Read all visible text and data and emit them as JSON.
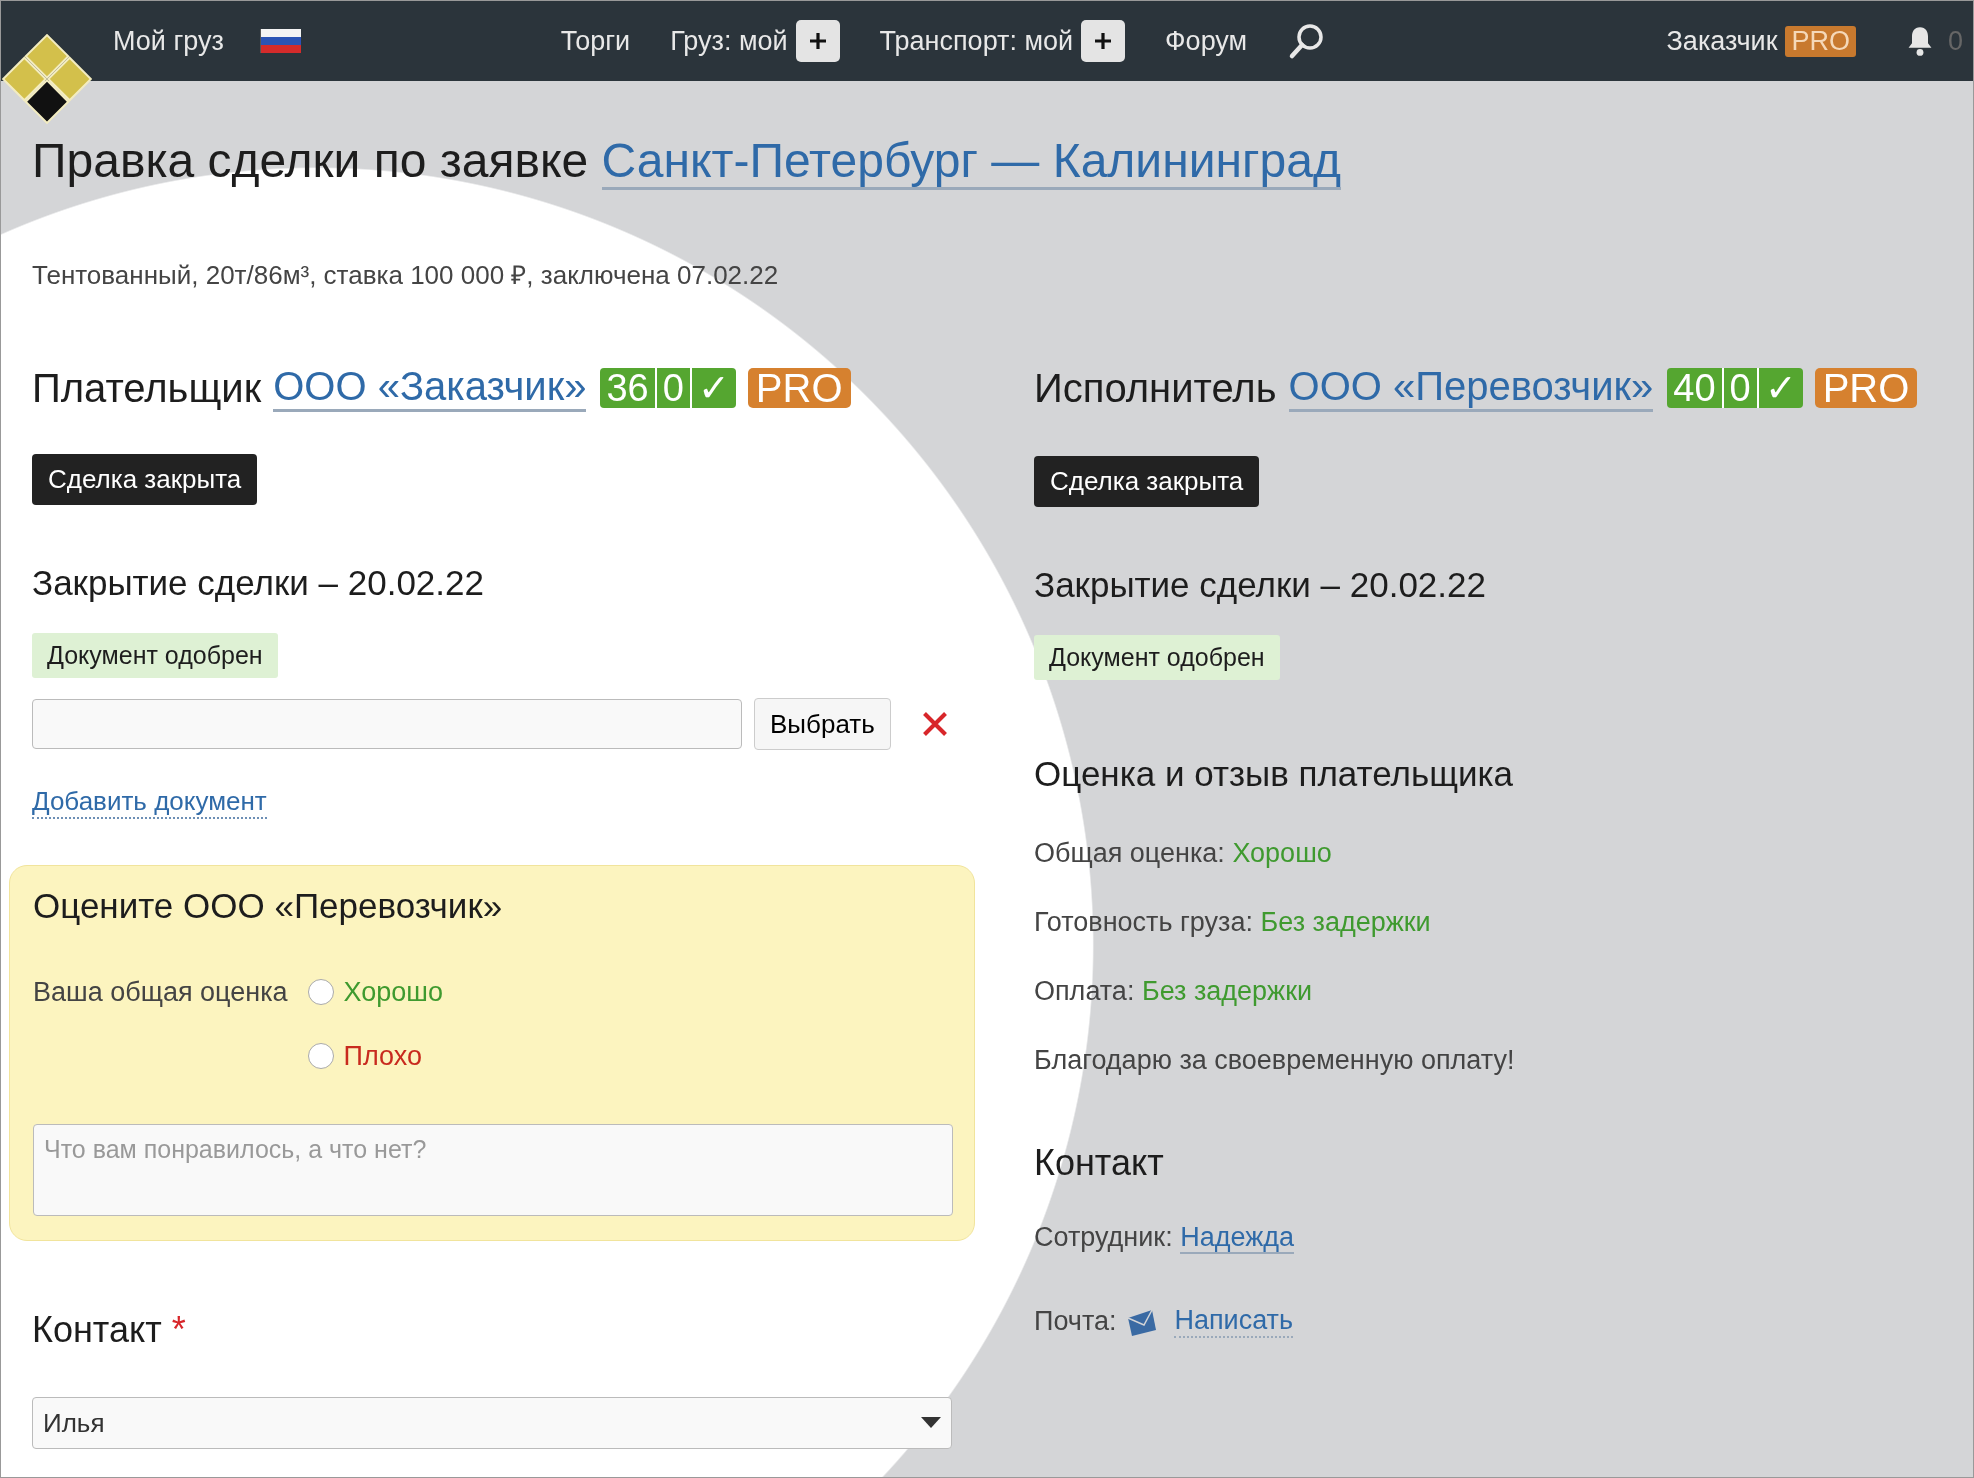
{
  "header": {
    "my_cargo": "Мой груз",
    "nav": [
      {
        "label": "Торги",
        "add_button": false
      },
      {
        "label": "Груз: мой",
        "add_button": true
      },
      {
        "label": "Транспорт: мой",
        "add_button": true
      },
      {
        "label": "Форум",
        "add_button": false
      }
    ],
    "user": {
      "name": "Заказчик",
      "badge": "PRO"
    },
    "notifications": {
      "count": "0"
    }
  },
  "title": {
    "prefix": "Правка сделки по заявке",
    "link": "Санкт-Петербург — Калининград"
  },
  "subtitle": "Тентованный, 20т/86м³, ставка 100 000 ₽, заключена 07.02.22",
  "payer": {
    "role": "Плательщик",
    "company": "ООО «Заказчик»",
    "rating": [
      "36",
      "0",
      "✓"
    ],
    "pro": "PRO",
    "status_button": "Сделка закрыта",
    "closing_title": "Закрытие сделки – 20.02.22",
    "doc_status": "Документ одобрен",
    "file_button": "Выбрать",
    "add_document": "Добавить документ",
    "rate_box": {
      "title": "Оцените ООО «Перевозчик»",
      "label": "Ваша общая оценка",
      "options": [
        {
          "label": "Хорошо",
          "kind": "good",
          "selected": false
        },
        {
          "label": "Плохо",
          "kind": "bad",
          "selected": false
        }
      ],
      "comment_placeholder": "Что вам понравилось, а что нет?"
    },
    "contact": {
      "title": "Контакт",
      "required_mark": "*",
      "select_value": "Илья"
    }
  },
  "executor": {
    "role": "Исполнитель",
    "company": "ООО «Перевозчик»",
    "rating": [
      "40",
      "0",
      "✓"
    ],
    "pro": "PRO",
    "status_button": "Сделка закрыта",
    "closing_title": "Закрытие сделки – 20.02.22",
    "doc_status": "Документ одобрен",
    "review": {
      "title": "Оценка и отзыв плательщика",
      "lines": [
        {
          "label": "Общая оценка:",
          "value": "Хорошо"
        },
        {
          "label": "Готовность груза:",
          "value": "Без задержки"
        },
        {
          "label": "Оплата:",
          "value": "Без задержки"
        }
      ],
      "comment": "Благодарю за своевременную оплату!"
    },
    "contact": {
      "title": "Контакт",
      "employee_label": "Сотрудник:",
      "employee": "Надежда",
      "mail_label": "Почта:",
      "mail_link": "Написать"
    }
  }
}
